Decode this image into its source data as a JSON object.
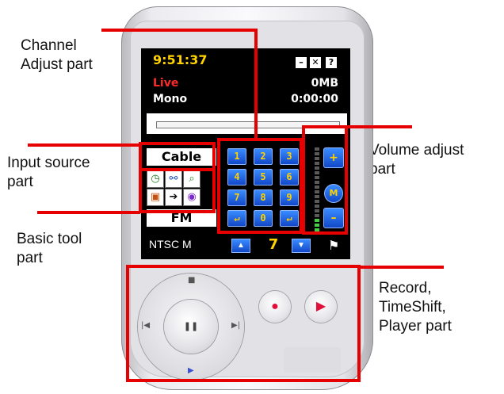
{
  "labels": {
    "channel_adjust": "Channel\nAdjust part",
    "input_source": "Input source\npart",
    "basic_tool": "Basic tool\npart",
    "volume_adjust": "Volume adjust\npart",
    "record_player": "Record,\nTimeShift,\nPlayer part"
  },
  "screen": {
    "time": "9:51:37",
    "status": "Live",
    "audio": "Mono",
    "size": "0MB",
    "elapsed": "0:00:00",
    "window_buttons": [
      "–",
      "✕",
      "?"
    ]
  },
  "input": {
    "source": "Cable",
    "band": "FM",
    "standard": "NTSC M"
  },
  "tool_icons": [
    "clock-icon",
    "connect-icon",
    "search-icon",
    "snapshot-icon",
    "skip-icon",
    "broadcast-icon"
  ],
  "keypad": [
    "1",
    "2",
    "3",
    "4",
    "5",
    "6",
    "7",
    "8",
    "9",
    "↵",
    "0",
    "↵"
  ],
  "channel": {
    "number": "7"
  },
  "volume": {
    "up": "+",
    "mute": "M",
    "down": "–"
  },
  "colors": {
    "annotation_line": "#e60000",
    "lcd_background": "#000000",
    "time_text": "#ffd200",
    "live_text": "#ff2a2a",
    "key_blue": "#1f5fe0"
  }
}
